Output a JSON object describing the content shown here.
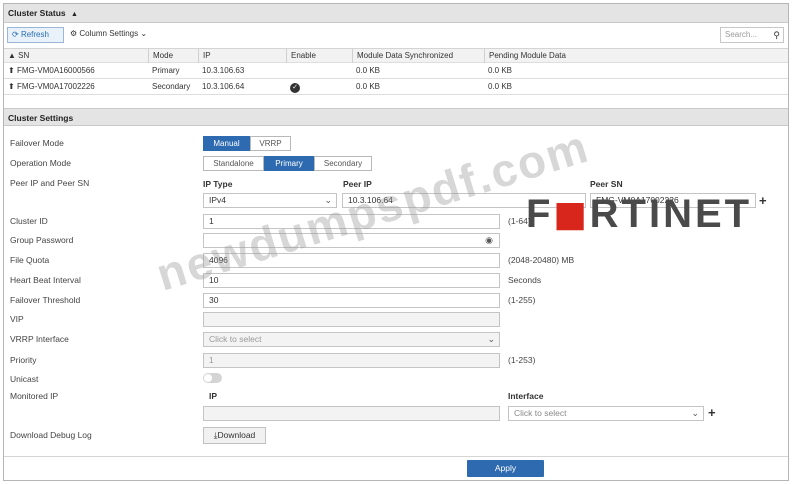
{
  "cluster_status": {
    "title": "Cluster Status",
    "title_icon": "arrow-up-icon",
    "toolbar": {
      "refresh_label": "Refresh",
      "column_settings_label": "Column Settings",
      "search_placeholder": "Search..."
    },
    "columns": [
      "SN",
      "Mode",
      "IP",
      "Enable",
      "Module Data Synchronized",
      "Pending Module Data"
    ],
    "rows": [
      {
        "sn": "FMG-VM0A16000566",
        "mode": "Primary",
        "ip": "10.3.106.63",
        "enable": "",
        "synced": "0.0 KB",
        "pending": "0.0 KB"
      },
      {
        "sn": "FMG-VM0A17002226",
        "mode": "Secondary",
        "ip": "10.3.106.64",
        "enable": "check",
        "synced": "0.0 KB",
        "pending": "0.0 KB"
      }
    ]
  },
  "cluster_settings": {
    "title": "Cluster Settings",
    "failover_mode": {
      "label": "Failover Mode",
      "options": [
        "Manual",
        "VRRP"
      ],
      "selected": "Manual"
    },
    "operation_mode": {
      "label": "Operation Mode",
      "options": [
        "Standalone",
        "Primary",
        "Secondary"
      ],
      "selected": "Primary"
    },
    "peer": {
      "label": "Peer IP and Peer SN",
      "ip_type_header": "IP Type",
      "peer_ip_header": "Peer IP",
      "peer_sn_header": "Peer SN",
      "ip_type_value": "IPv4",
      "peer_ip_value": "10.3.106.64",
      "peer_sn_value": "FMG-VM0A17002226"
    },
    "cluster_id": {
      "label": "Cluster ID",
      "value": "1",
      "hint": "(1-64)"
    },
    "group_password": {
      "label": "Group Password",
      "value": ""
    },
    "file_quota": {
      "label": "File Quota",
      "value": "4096",
      "hint": "(2048-20480) MB"
    },
    "heart_beat": {
      "label": "Heart Beat Interval",
      "value": "10",
      "hint": "Seconds"
    },
    "failover_threshold": {
      "label": "Failover Threshold",
      "value": "30",
      "hint": "(1-255)"
    },
    "vip": {
      "label": "VIP",
      "value": ""
    },
    "vrrp_interface": {
      "label": "VRRP Interface",
      "placeholder": "Click to select"
    },
    "priority": {
      "label": "Priority",
      "value": "1",
      "hint": "(1-253)"
    },
    "unicast": {
      "label": "Unicast",
      "enabled": false
    },
    "monitored_ip": {
      "label": "Monitored IP",
      "ip_header": "IP",
      "interface_header": "Interface",
      "interface_placeholder": "Click to select"
    },
    "debug_log": {
      "label": "Download Debug Log",
      "button_label": "Download"
    },
    "apply_label": "Apply"
  },
  "watermark": "newdumpspdf.com",
  "brand_logo": {
    "prefix": "F",
    "red": "◼",
    "suffix": "RTINET",
    "colors": {
      "text": "#4a4a4a",
      "accent": "#d9261c"
    }
  },
  "colors": {
    "accent": "#2d6ab0",
    "header_bg": "#e4e4e4"
  }
}
